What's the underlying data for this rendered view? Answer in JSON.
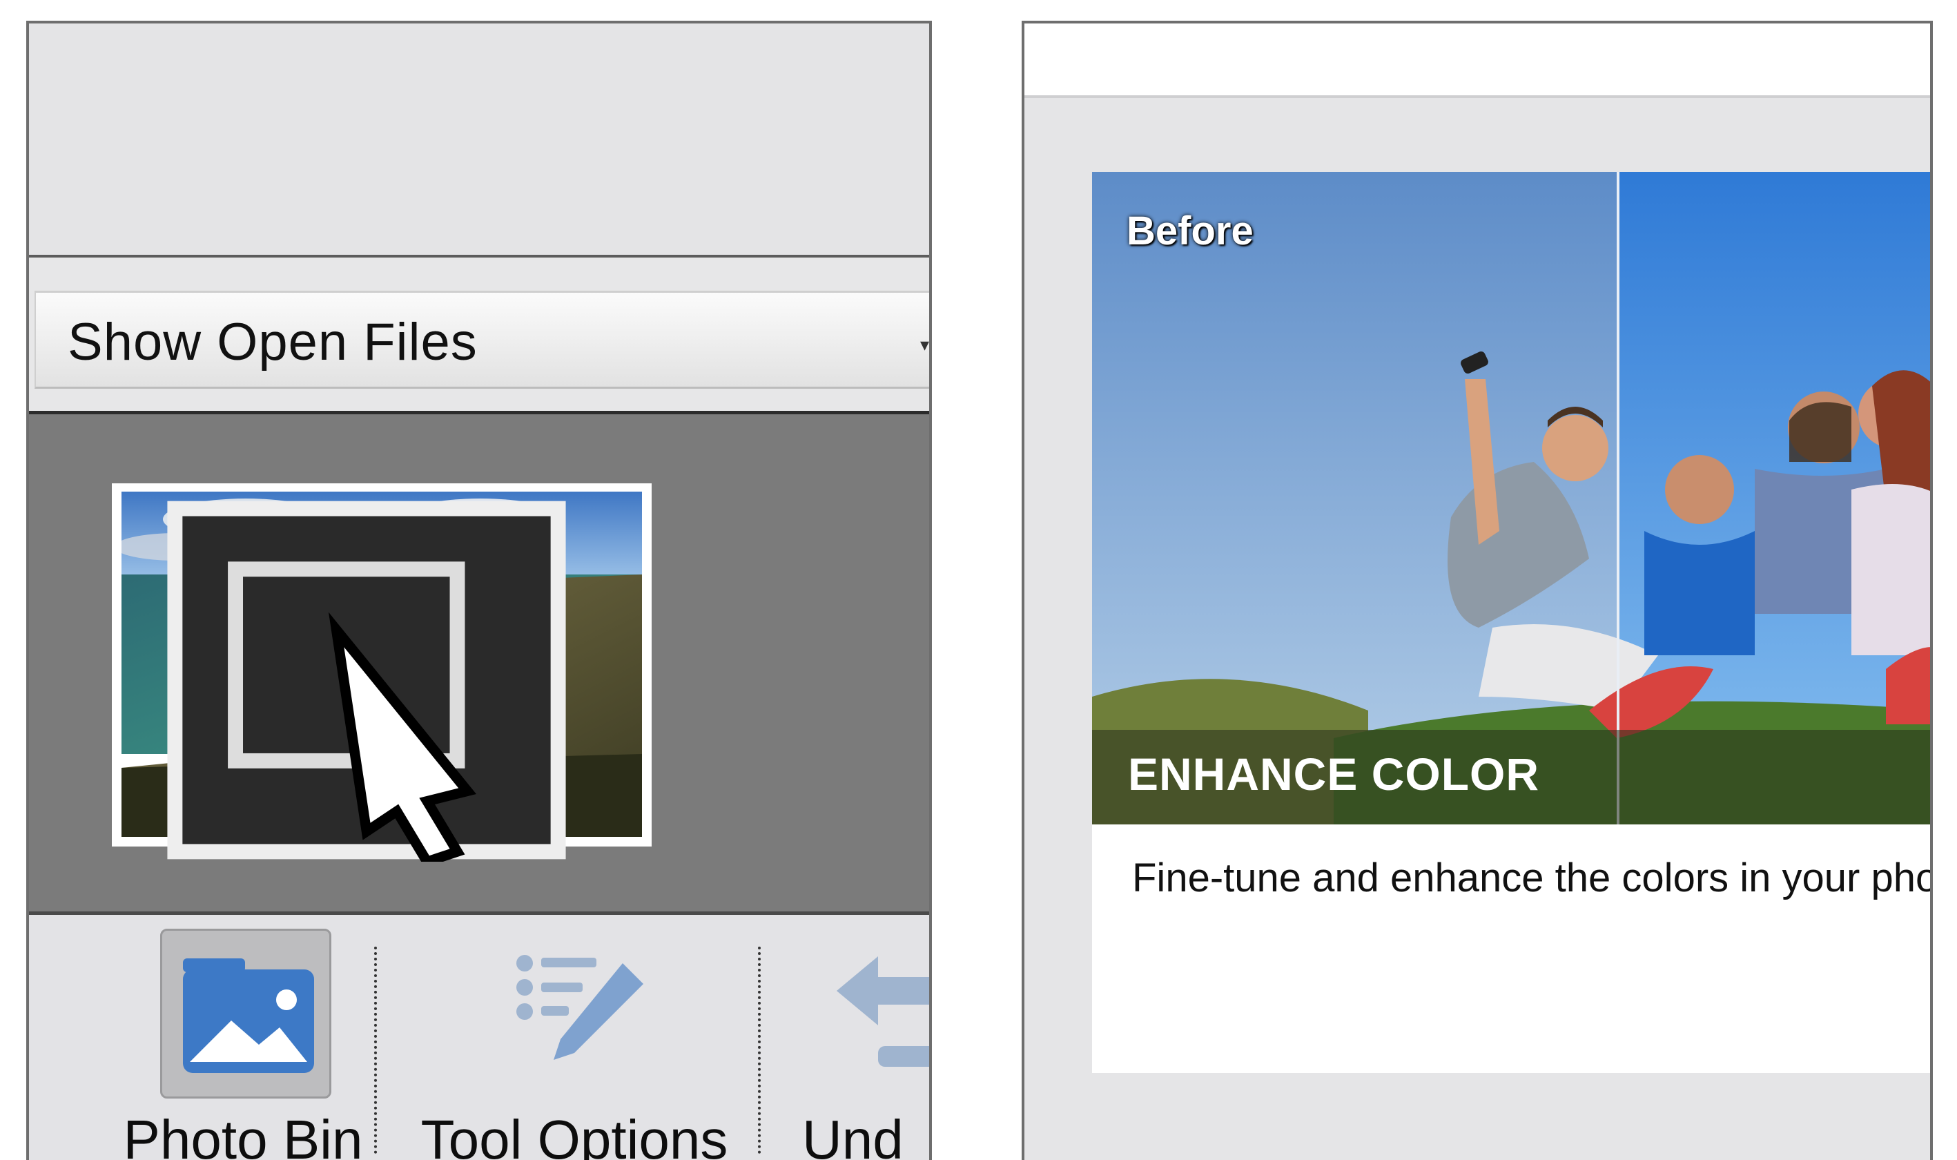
{
  "left_panel": {
    "dropdown": {
      "label": "Show Open Files",
      "arrow": "▾"
    },
    "taskbar": {
      "photo_bin": {
        "label": "Photo Bin",
        "icon": "image-folder-icon"
      },
      "tool_options": {
        "label": "Tool Options",
        "icon": "tool-options-icon"
      },
      "undo": {
        "label": "Und",
        "icon": "undo-icon"
      }
    }
  },
  "right_panel": {
    "card": {
      "before_label": "Before",
      "title": "ENHANCE COLOR",
      "description": "Fine-tune and enhance the colors in your photo."
    }
  },
  "colors": {
    "panel_bg": "#e4e4e6",
    "bin_bg": "#7b7b7b",
    "icon_blue": "#3d79c6",
    "card_bg": "#ffffff"
  }
}
